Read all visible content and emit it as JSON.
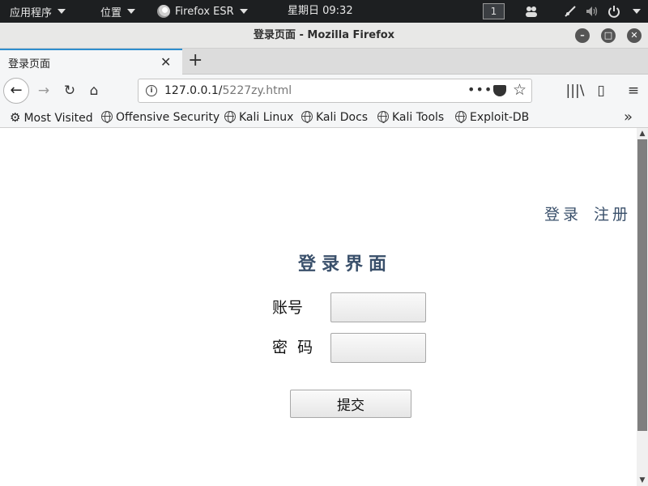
{
  "topbar": {
    "apps_label": "应用程序",
    "places_label": "位置",
    "app_label": "Firefox ESR",
    "clock": "星期日 09:32",
    "workspace": "1",
    "icons": [
      "people-icon",
      "network-icon",
      "volume-icon",
      "power-icon"
    ]
  },
  "window": {
    "title": "登录页面 - Mozilla Firefox",
    "controls": [
      "minimize-icon",
      "maximize-icon",
      "close-icon"
    ]
  },
  "tabs": {
    "active_label": "登录页面",
    "close_glyph": "✕",
    "new_tab_glyph": "+"
  },
  "nav": {
    "back_glyph": "←",
    "forward_glyph": "→",
    "reload_glyph": "↻",
    "home_glyph": "⌂",
    "url_host": "127.0.0.1/",
    "url_path": "5227zy.html",
    "more_glyph": "•••",
    "star_glyph": "☆",
    "library_glyph": "|||\\",
    "sidebar_glyph": "▯",
    "menu_glyph": "≡"
  },
  "bookmarks": {
    "items": [
      "Most Visited",
      "Offensive Security",
      "Kali Linux",
      "Kali Docs",
      "Kali Tools",
      "Exploit-DB"
    ],
    "gear_glyph": "⚙",
    "overflow_glyph": "»"
  },
  "page": {
    "link_login": "登录",
    "link_register": "注册",
    "form_title": "登录界面",
    "account_label": "账号",
    "password_label": "密  码",
    "account_value": "",
    "password_value": "",
    "submit_label": "提交"
  },
  "colors": {
    "accent": "#3a506b",
    "tab_highlight": "#2e8ece",
    "topbar_bg": "#1d1f21"
  }
}
